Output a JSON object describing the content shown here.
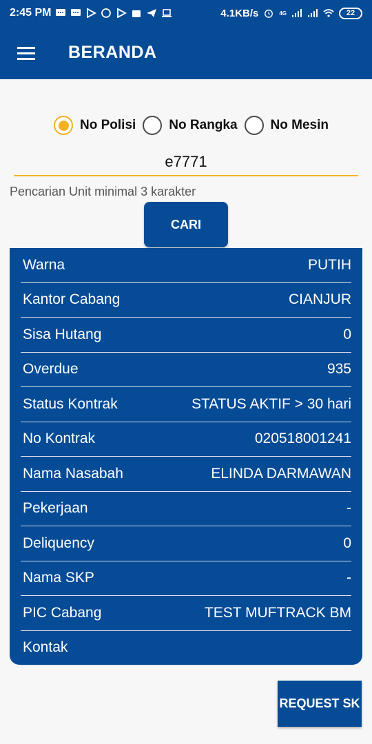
{
  "status_bar": {
    "time": "2:45 PM",
    "net_speed": "4.1KB/s",
    "network_type": "4G",
    "battery": "22"
  },
  "app_bar": {
    "title": "BERANDA"
  },
  "search": {
    "options": [
      "No Polisi",
      "No Rangka",
      "No Mesin"
    ],
    "selected_index": 0,
    "value": "e7771",
    "hint": "Pencarian Unit minimal 3 karakter",
    "button_label": "CARI"
  },
  "details": [
    {
      "label": "Warna",
      "value": "PUTIH"
    },
    {
      "label": "Kantor Cabang",
      "value": "CIANJUR"
    },
    {
      "label": "Sisa Hutang",
      "value": "0"
    },
    {
      "label": "Overdue",
      "value": "935"
    },
    {
      "label": "Status Kontrak",
      "value": "STATUS AKTIF > 30 hari"
    },
    {
      "label": "No Kontrak",
      "value": "020518001241"
    },
    {
      "label": "Nama Nasabah",
      "value": "ELINDA DARMAWAN"
    },
    {
      "label": "Pekerjaan",
      "value": "-"
    },
    {
      "label": "Deliquency",
      "value": "0"
    },
    {
      "label": "Nama SKP",
      "value": "-"
    },
    {
      "label": "PIC Cabang",
      "value": "TEST MUFTRACK BM"
    },
    {
      "label": "Kontak",
      "value": ""
    }
  ],
  "request_button_label": "REQUEST SK",
  "colors": {
    "primary": "#064b96",
    "accent": "#f4b120"
  }
}
